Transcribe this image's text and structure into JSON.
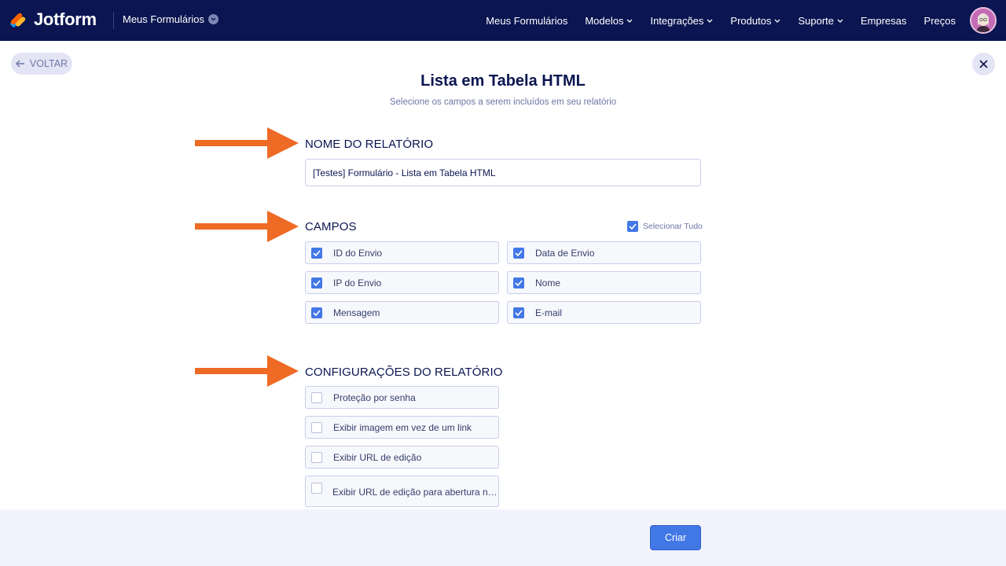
{
  "nav": {
    "brand": "Jotform",
    "my_forms": "Meus Formulários",
    "links": [
      {
        "label": "Meus Formulários",
        "dropdown": false
      },
      {
        "label": "Modelos",
        "dropdown": true
      },
      {
        "label": "Integrações",
        "dropdown": true
      },
      {
        "label": "Produtos",
        "dropdown": true
      },
      {
        "label": "Suporte",
        "dropdown": true
      },
      {
        "label": "Empresas",
        "dropdown": false
      },
      {
        "label": "Preços",
        "dropdown": false
      }
    ]
  },
  "back_label": "VOLTAR",
  "page": {
    "title": "Lista em Tabela HTML",
    "subtitle": "Selecione os campos a serem incluídos em seu relatório"
  },
  "report_name": {
    "heading": "NOME DO RELATÓRIO",
    "value": "[Testes] Formulário - Lista em Tabela HTML"
  },
  "fields": {
    "heading": "CAMPOS",
    "select_all_label": "Selecionar Tudo",
    "select_all_checked": true,
    "items": [
      {
        "label": "ID do Envio",
        "checked": true
      },
      {
        "label": "Data de Envio",
        "checked": true
      },
      {
        "label": "IP do Envio",
        "checked": true
      },
      {
        "label": "Nome",
        "checked": true
      },
      {
        "label": "Mensagem",
        "checked": true
      },
      {
        "label": "E-mail",
        "checked": true
      }
    ]
  },
  "settings": {
    "heading": "CONFIGURAÇÕES DO RELATÓRIO",
    "items": [
      {
        "label": "Proteção por senha",
        "checked": false
      },
      {
        "label": "Exibir imagem em vez de um link",
        "checked": false
      },
      {
        "label": "Exibir URL de edição",
        "checked": false
      },
      {
        "label": "Exibir URL de edição para abertura na ...",
        "checked": false
      }
    ]
  },
  "footer": {
    "create_label": "Criar"
  },
  "colors": {
    "navy": "#0a1551",
    "accent_blue": "#4277e6",
    "annotation_orange": "#ee6a25",
    "muted": "#6f76a7"
  }
}
